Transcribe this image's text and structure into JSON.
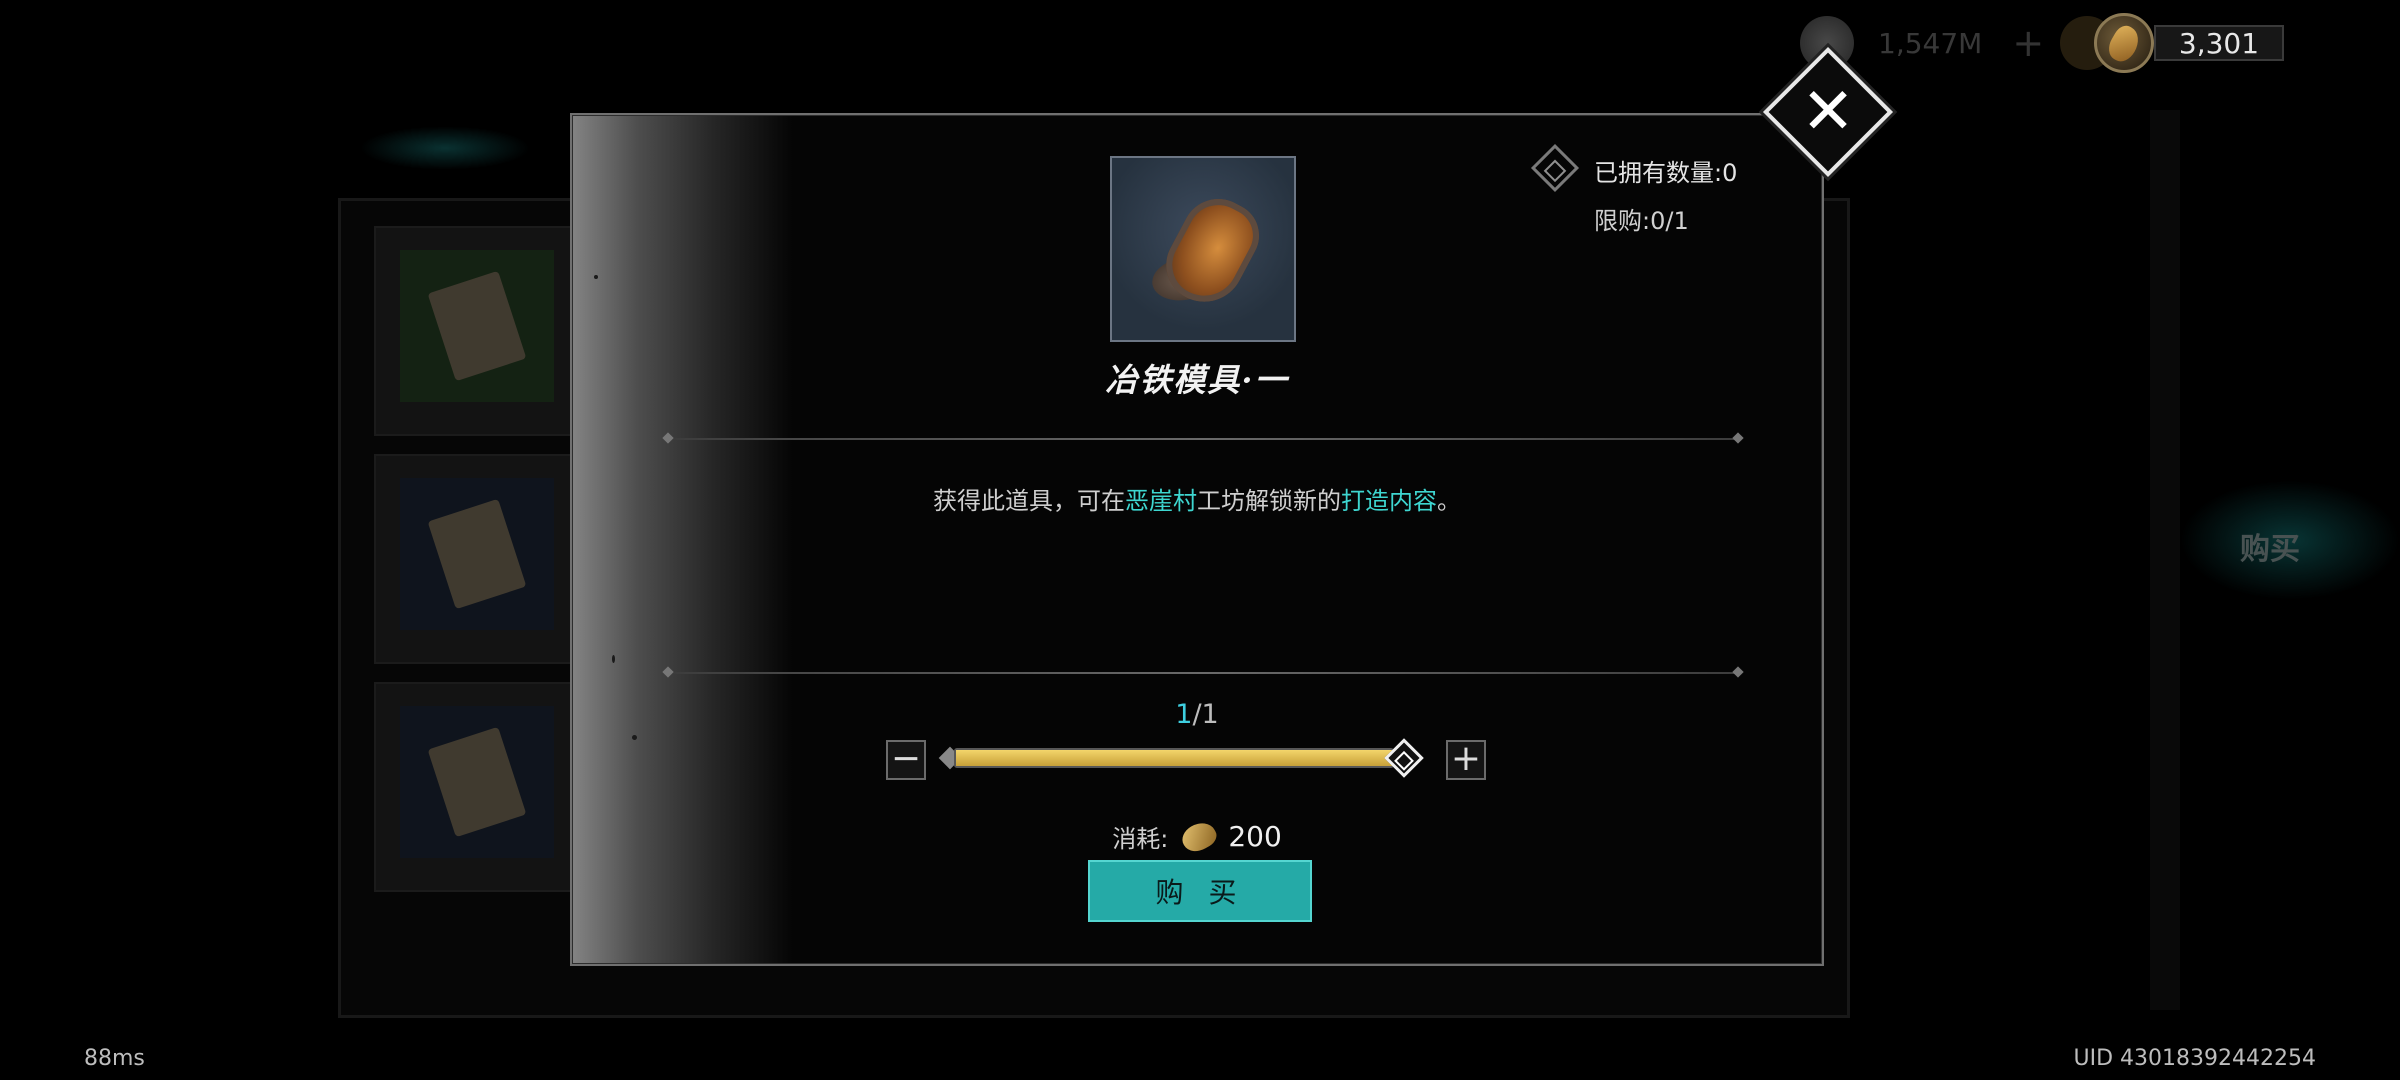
{
  "topbar": {
    "currency1_value": "1,547M",
    "currency1_plus": "+",
    "currency2_value": "3,301"
  },
  "modal": {
    "close_glyph": "✕",
    "item_name": "冶铁模具·一",
    "owned_label": "已拥有数量:0",
    "limit_label": "限购:0/1",
    "description": {
      "part1": "获得此道具，可在",
      "highlight1": "恶崖村",
      "part2": "工坊解锁新的",
      "highlight2": "打造内容",
      "part3": "。"
    },
    "quantity_current": "1",
    "quantity_total": "/1",
    "quantity_fraction": 1.0,
    "minus_glyph": "−",
    "plus_glyph": "+",
    "cost_label": "消耗:",
    "cost_amount": "200",
    "buy_label": "购 买"
  },
  "background": {
    "right_tab_label": "购买"
  },
  "footer": {
    "ping": "88ms",
    "uid": "UID 43018392442254"
  },
  "colors": {
    "accent": "#25aaa7",
    "highlight": "#3ed6d0",
    "slider_fill": "#d9b44a"
  }
}
